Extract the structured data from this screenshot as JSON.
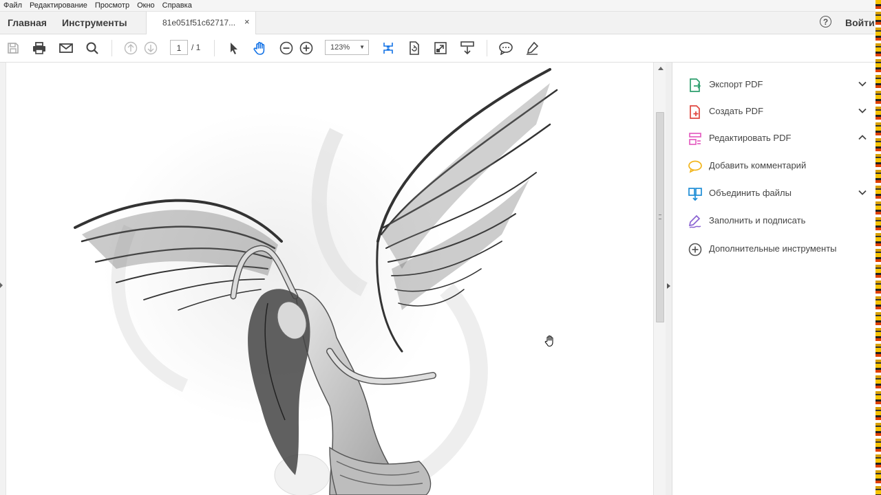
{
  "menu": [
    "Файл",
    "Редактирование",
    "Просмотр",
    "Окно",
    "Справка"
  ],
  "tabs": {
    "home": "Главная",
    "tools": "Инструменты",
    "document": "81e051f51c62717...",
    "close": "×"
  },
  "header": {
    "help": "?",
    "signin": "Войти"
  },
  "toolbar": {
    "page_current": "1",
    "page_total": "/ 1",
    "zoom": "123%"
  },
  "panel": {
    "items": [
      {
        "label": "Экспорт PDF",
        "icon": "export-pdf-icon",
        "color": "#2d9e6d",
        "chevron": "down"
      },
      {
        "label": "Создать PDF",
        "icon": "create-pdf-icon",
        "color": "#e0463e",
        "chevron": "down"
      },
      {
        "label": "Редактировать PDF",
        "icon": "edit-pdf-icon",
        "color": "#e45fc1",
        "chevron": "up"
      },
      {
        "label": "Добавить комментарий",
        "icon": "comment-icon",
        "color": "#f2b51c",
        "chevron": ""
      },
      {
        "label": "Объединить файлы",
        "icon": "combine-files-icon",
        "color": "#1f8ed6",
        "chevron": "down"
      },
      {
        "label": "Заполнить и подписать",
        "icon": "fill-sign-icon",
        "color": "#8a63d2",
        "chevron": ""
      },
      {
        "label": "Дополнительные инструменты",
        "icon": "more-tools-icon",
        "color": "#555555",
        "chevron": ""
      }
    ]
  },
  "accent": "#1473e6"
}
